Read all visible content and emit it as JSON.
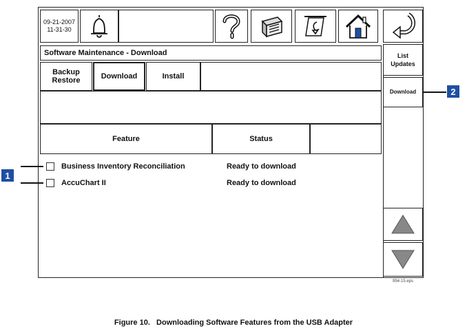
{
  "header": {
    "date": "09-21-2007",
    "time": "11-31-30",
    "icons": [
      "bell-icon",
      "help-icon",
      "bag-icon",
      "receipt-icon",
      "home-icon",
      "back-arrow-icon"
    ]
  },
  "screen": {
    "title": "Software Maintenance - Download",
    "tabs": [
      {
        "label": "Backup\nRestore"
      },
      {
        "label": "Download",
        "active": true
      },
      {
        "label": "Install"
      }
    ],
    "table": {
      "columns": [
        "Feature",
        "Status"
      ],
      "rows": [
        {
          "feature": "Business Inventory Reconciliation",
          "status": "Ready to download"
        },
        {
          "feature": "AccuChart II",
          "status": "Ready to download"
        }
      ]
    },
    "side": {
      "list_updates": "List Updates",
      "download": "Download"
    }
  },
  "callouts": {
    "one": "1",
    "two": "2"
  },
  "file_code": "954-15.eps",
  "caption": "Figure 10.   Downloading Software Features from the USB Adapter"
}
